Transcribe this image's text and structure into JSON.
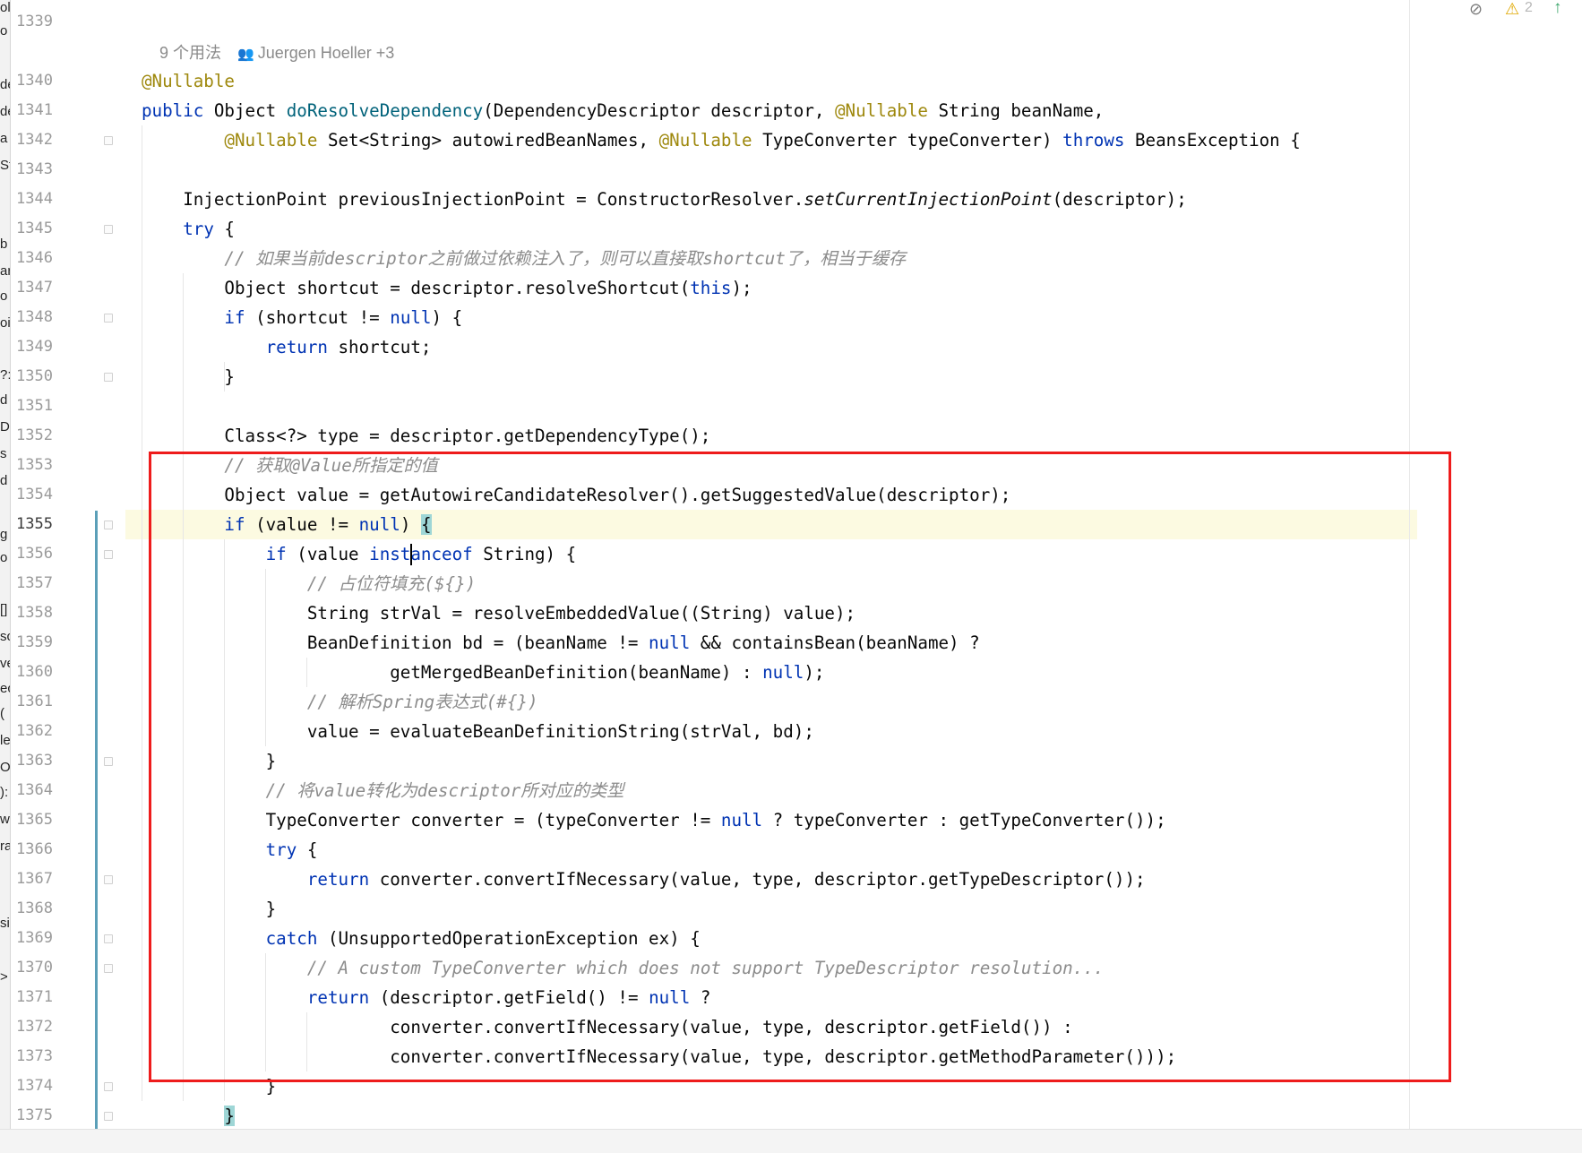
{
  "gutter": {
    "line_numbers": [
      "1339",
      "1340",
      "1341",
      "1342",
      "1343",
      "1344",
      "1345",
      "1346",
      "1347",
      "1348",
      "1349",
      "1350",
      "1351",
      "1352",
      "1353",
      "1354",
      "1355",
      "1356",
      "1357",
      "1358",
      "1359",
      "1360",
      "1361",
      "1362",
      "1363",
      "1364",
      "1365",
      "1366",
      "1367",
      "1368",
      "1369",
      "1370",
      "1371",
      "1372",
      "1373",
      "1374",
      "1375"
    ],
    "current_line": "1355"
  },
  "inlay_hint": {
    "usages": "9 个用法",
    "authors": "Juergen Hoeller +3",
    "people_icon": "people-icon"
  },
  "left_strip_letters": [
    "ol",
    "o",
    "de",
    "de",
    "a",
    "St",
    "b",
    "ar",
    "o",
    "oi",
    "?:",
    "d",
    "De",
    "s",
    "d",
    "g",
    "o",
    "[]",
    "sc",
    "ve",
    "ec",
    "(",
    "le",
    "O",
    "):",
    "w",
    "ra",
    "si",
    ">"
  ],
  "status": {
    "hidden_icon": "eye-slash-icon",
    "warning_icon": "warning-icon",
    "warning_count": "2",
    "nav_icon": "arrow-up-icon"
  },
  "colors": {
    "keyword": "#0033b3",
    "annotation": "#9e880d",
    "method_decl": "#00627a",
    "comment": "#8c8c8c",
    "highlight_box": "#ee1c1c",
    "current_line_bg": "#fcfae1"
  },
  "code_lines": [
    {
      "tokens": []
    },
    {
      "tokens": [
        {
          "t": "@Nullable",
          "c": "an"
        }
      ]
    },
    {
      "tokens": [
        {
          "t": "public",
          "c": "kw"
        },
        {
          "t": " Object "
        },
        {
          "t": "doResolveDependency",
          "c": "fn"
        },
        {
          "t": "(DependencyDescriptor descriptor, "
        },
        {
          "t": "@Nullable",
          "c": "an"
        },
        {
          "t": " String beanName,"
        }
      ]
    },
    {
      "tokens": [
        {
          "t": "        "
        },
        {
          "t": "@Nullable",
          "c": "an"
        },
        {
          "t": " Set<String> autowiredBeanNames, "
        },
        {
          "t": "@Nullable",
          "c": "an"
        },
        {
          "t": " TypeConverter typeConverter) "
        },
        {
          "t": "throws",
          "c": "kw"
        },
        {
          "t": " BeansException {"
        }
      ]
    },
    {
      "tokens": []
    },
    {
      "tokens": [
        {
          "t": "    InjectionPoint previousInjectionPoint = ConstructorResolver."
        },
        {
          "t": "setCurrentInjectionPoint",
          "c": "it"
        },
        {
          "t": "(descriptor);"
        }
      ]
    },
    {
      "tokens": [
        {
          "t": "    "
        },
        {
          "t": "try",
          "c": "kw"
        },
        {
          "t": " {"
        }
      ]
    },
    {
      "tokens": [
        {
          "t": "        "
        },
        {
          "t": "// 如果当前descriptor之前做过依赖注入了，则可以直接取shortcut了，相当于缓存",
          "c": "cm"
        }
      ]
    },
    {
      "tokens": [
        {
          "t": "        Object shortcut = descriptor.resolveShortcut("
        },
        {
          "t": "this",
          "c": "kw"
        },
        {
          "t": ");"
        }
      ]
    },
    {
      "tokens": [
        {
          "t": "        "
        },
        {
          "t": "if",
          "c": "kw"
        },
        {
          "t": " (shortcut != "
        },
        {
          "t": "null",
          "c": "kw"
        },
        {
          "t": ") {"
        }
      ]
    },
    {
      "tokens": [
        {
          "t": "            "
        },
        {
          "t": "return",
          "c": "kw"
        },
        {
          "t": " shortcut;"
        }
      ]
    },
    {
      "tokens": [
        {
          "t": "        }"
        }
      ]
    },
    {
      "tokens": []
    },
    {
      "tokens": [
        {
          "t": "        Class<?> type = descriptor.getDependencyType();"
        }
      ]
    },
    {
      "tokens": [
        {
          "t": "        "
        },
        {
          "t": "// 获取@Value所指定的值",
          "c": "cm"
        }
      ]
    },
    {
      "tokens": [
        {
          "t": "        Object value = getAutowireCandidateResolver().getSuggestedValue(descriptor);"
        }
      ]
    },
    {
      "tokens": [
        {
          "t": "        "
        },
        {
          "t": "if",
          "c": "kw"
        },
        {
          "t": " (value != "
        },
        {
          "t": "null",
          "c": "kw"
        },
        {
          "t": ") "
        },
        {
          "t": "{",
          "c": "brace-hl"
        }
      ]
    },
    {
      "tokens": [
        {
          "t": "            "
        },
        {
          "t": "if",
          "c": "kw"
        },
        {
          "t": " (value "
        },
        {
          "t": "instanceof",
          "c": "kw"
        },
        {
          "t": " String) {"
        }
      ]
    },
    {
      "tokens": [
        {
          "t": "                "
        },
        {
          "t": "// 占位符填充(${})",
          "c": "cm"
        }
      ]
    },
    {
      "tokens": [
        {
          "t": "                String strVal = resolveEmbeddedValue((String) value);"
        }
      ]
    },
    {
      "tokens": [
        {
          "t": "                BeanDefinition bd = (beanName != "
        },
        {
          "t": "null",
          "c": "kw"
        },
        {
          "t": " && containsBean(beanName) ?"
        }
      ]
    },
    {
      "tokens": [
        {
          "t": "                        getMergedBeanDefinition(beanName) : "
        },
        {
          "t": "null",
          "c": "kw"
        },
        {
          "t": ");"
        }
      ]
    },
    {
      "tokens": [
        {
          "t": "                "
        },
        {
          "t": "// 解析Spring表达式(#{})",
          "c": "cm"
        }
      ]
    },
    {
      "tokens": [
        {
          "t": "                value = evaluateBeanDefinitionString(strVal, bd);"
        }
      ]
    },
    {
      "tokens": [
        {
          "t": "            }"
        }
      ]
    },
    {
      "tokens": [
        {
          "t": "            "
        },
        {
          "t": "// 将value转化为descriptor所对应的类型",
          "c": "cm"
        }
      ]
    },
    {
      "tokens": [
        {
          "t": "            TypeConverter converter = (typeConverter != "
        },
        {
          "t": "null",
          "c": "kw"
        },
        {
          "t": " ? typeConverter : getTypeConverter());"
        }
      ]
    },
    {
      "tokens": [
        {
          "t": "            "
        },
        {
          "t": "try",
          "c": "kw"
        },
        {
          "t": " {"
        }
      ]
    },
    {
      "tokens": [
        {
          "t": "                "
        },
        {
          "t": "return",
          "c": "kw"
        },
        {
          "t": " converter.convertIfNecessary(value, type, descriptor.getTypeDescriptor());"
        }
      ]
    },
    {
      "tokens": [
        {
          "t": "            }"
        }
      ]
    },
    {
      "tokens": [
        {
          "t": "            "
        },
        {
          "t": "catch",
          "c": "kw"
        },
        {
          "t": " (UnsupportedOperationException ex) {"
        }
      ]
    },
    {
      "tokens": [
        {
          "t": "                "
        },
        {
          "t": "// A custom TypeConverter which does not support TypeDescriptor resolution...",
          "c": "cm"
        }
      ]
    },
    {
      "tokens": [
        {
          "t": "                "
        },
        {
          "t": "return",
          "c": "kw"
        },
        {
          "t": " (descriptor.getField() != "
        },
        {
          "t": "null",
          "c": "kw"
        },
        {
          "t": " ?"
        }
      ]
    },
    {
      "tokens": [
        {
          "t": "                        converter.convertIfNecessary(value, type, descriptor.getField()) :"
        }
      ]
    },
    {
      "tokens": [
        {
          "t": "                        converter.convertIfNecessary(value, type, descriptor.getMethodParameter()));"
        }
      ]
    },
    {
      "tokens": [
        {
          "t": "            }"
        }
      ]
    },
    {
      "tokens": [
        {
          "t": "        "
        },
        {
          "t": "}",
          "c": "brace-hl"
        }
      ]
    }
  ]
}
